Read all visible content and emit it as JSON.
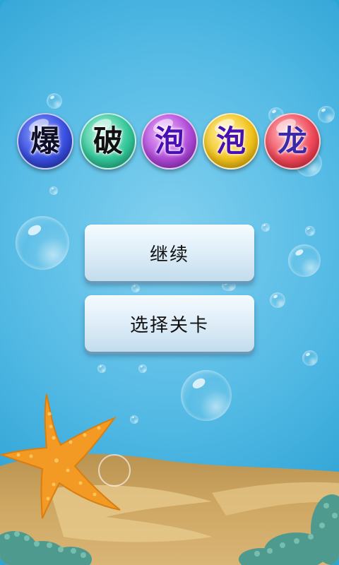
{
  "title": {
    "chars": [
      "爆",
      "破",
      "泡",
      "泡",
      "龙"
    ],
    "ball_colors": [
      "#3a4fe0",
      "#34c79a",
      "#b04ad8",
      "#f2c31c",
      "#ef4a5a"
    ]
  },
  "menu": {
    "continue_label": "继续",
    "select_level_label": "选择关卡"
  },
  "scene_colors": {
    "water": "#4fb8e3",
    "sand": "#c9a35e",
    "starfish": "#f0a028",
    "coral": "#5aa49a"
  }
}
